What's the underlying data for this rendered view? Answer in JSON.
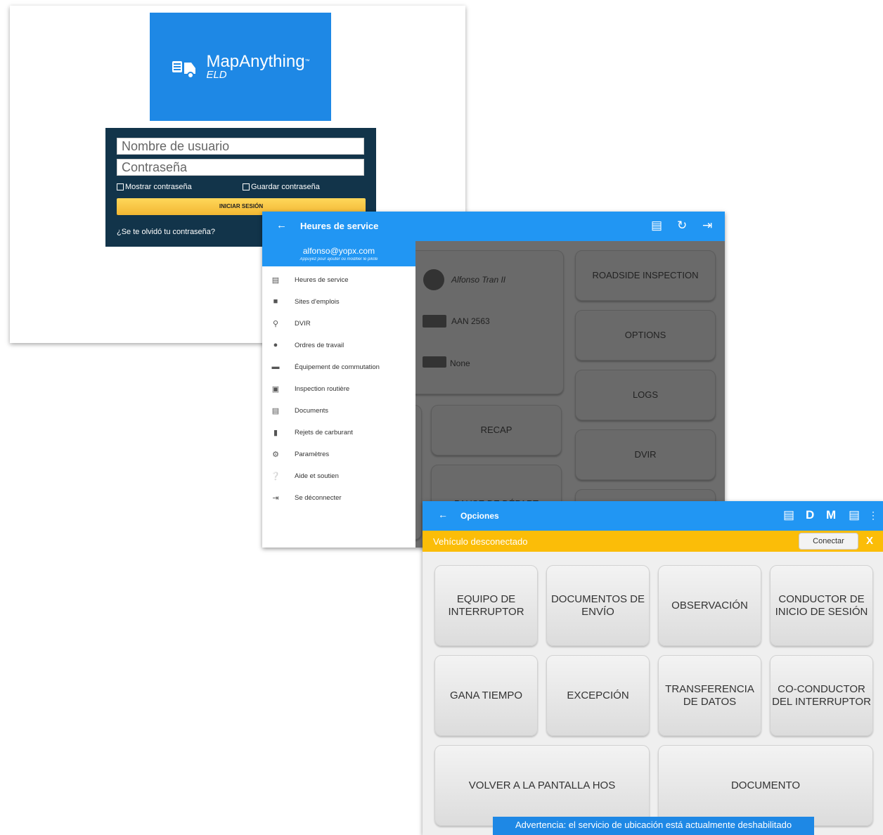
{
  "login": {
    "logo_brand": "MapAnything",
    "logo_sub": "ELD",
    "logo_tm": "™",
    "username_placeholder": "Nombre de usuario",
    "password_placeholder": "Contraseña",
    "show_password": "Mostrar contraseña",
    "save_password": "Guardar contraseña",
    "login_button": "INICIAR SESIÓN",
    "forgot": "¿Se te olvidó tu contraseña?"
  },
  "hos": {
    "title": "Heures de service",
    "driver_name": "Alfonso Tran II",
    "vehicle": "AAN 2563",
    "trailer": "None",
    "buttons": {
      "roadside": "ROADSIDE INSPECTION",
      "options": "OPTIONS",
      "logs": "LOGS",
      "dvir": "DVIR",
      "recap": "RECAP",
      "pause": "PAUSE DE DÉPART"
    },
    "drawer": {
      "email": "alfonso@yopx.com",
      "subtitle": "Appuyez pour ajouter ou modifier le pilote",
      "items": [
        {
          "label": "Heures de service",
          "icon": "clipboard-icon"
        },
        {
          "label": "Sites d'emplois",
          "icon": "briefcase-icon"
        },
        {
          "label": "DVIR",
          "icon": "search-icon"
        },
        {
          "label": "Ordres de travail",
          "icon": "person-icon"
        },
        {
          "label": "Équipement de commutation",
          "icon": "truck-icon"
        },
        {
          "label": "Inspection routière",
          "icon": "inspection-icon"
        },
        {
          "label": "Documents",
          "icon": "document-icon"
        },
        {
          "label": "Rejets de carburant",
          "icon": "fuel-icon"
        },
        {
          "label": "Paramètres",
          "icon": "gear-icon"
        },
        {
          "label": "Aide et soutien",
          "icon": "help-icon"
        },
        {
          "label": "Se déconnecter",
          "icon": "logout-icon"
        }
      ]
    }
  },
  "opciones": {
    "title": "Opciones",
    "toolbar": {
      "d": "D",
      "m": "M"
    },
    "status": "Vehículo desconectado",
    "connect": "Conectar",
    "close": "X",
    "buttons": {
      "b1": "EQUIPO DE INTERRUPTOR",
      "b2": "DOCUMENTOS DE ENVÍO",
      "b3": "OBSERVACIÓN",
      "b4": "CONDUCTOR DE INICIO DE SESIÓN",
      "b5": "GANA TIEMPO",
      "b6": "EXCEPCIÓN",
      "b7": "TRANSFERENCIA DE DATOS",
      "b8": "CO-CONDUCTOR DEL INTERRUPTOR",
      "b9": "VOLVER A LA PANTALLA HOS",
      "b10": "DOCUMENTO"
    },
    "warning": "Advertencia: el servicio de ubicación está actualmente deshabilitado"
  }
}
